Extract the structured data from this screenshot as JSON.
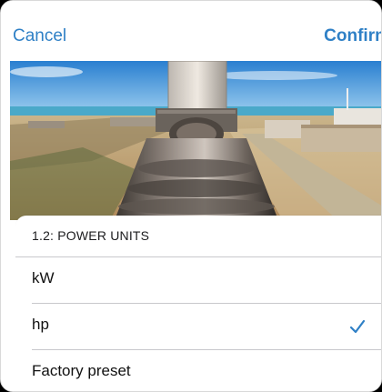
{
  "navbar": {
    "cancel_label": "Cancel",
    "confirm_label": "Confirm"
  },
  "sheet": {
    "title": "1.2:  POWER UNITS",
    "options": [
      {
        "label": "kW",
        "selected": false
      },
      {
        "label": "hp",
        "selected": true
      },
      {
        "label": "Factory preset",
        "selected": false
      }
    ]
  },
  "colors": {
    "accent": "#2f80c6",
    "divider": "#c8c8cc"
  },
  "icons": {
    "selected": "checkmark-icon"
  }
}
